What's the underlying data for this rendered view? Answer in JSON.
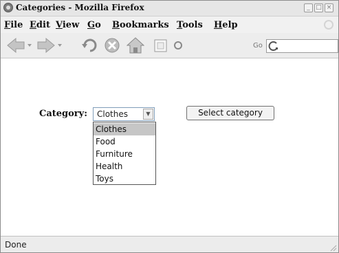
{
  "window": {
    "title": "Categories - Mozilla Firefox"
  },
  "menu": [
    "File",
    "Edit",
    "View",
    "Go",
    "Bookmarks",
    "Tools",
    "Help"
  ],
  "toolbar": {
    "go_label": "Go",
    "icons": [
      "back-arrow-icon",
      "forward-arrow-icon",
      "reload-icon",
      "stop-icon",
      "home-icon",
      "page-icon",
      "go-icon"
    ]
  },
  "form": {
    "category_label": "Category:",
    "selected_value": "Clothes",
    "options": [
      "Clothes",
      "Food",
      "Furniture",
      "Health",
      "Toys"
    ],
    "highlighted_option": "Clothes",
    "submit_label": "Select category"
  },
  "status": {
    "text": "Done"
  },
  "colors": {
    "highlight": "#c6c6c6",
    "select_border": "#7f9db9"
  }
}
